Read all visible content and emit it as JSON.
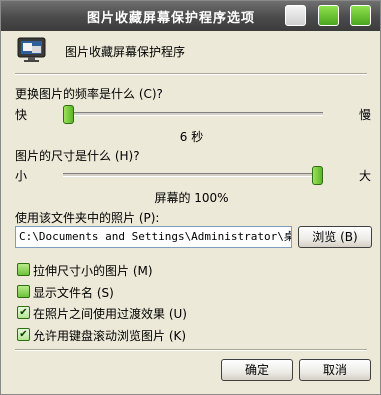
{
  "window": {
    "title": "图片收藏屏幕保护程序选项"
  },
  "header": {
    "app_name": "图片收藏屏幕保护程序"
  },
  "frequency": {
    "question": "更换图片的频率是什么 (C)?",
    "min_label": "快",
    "max_label": "慢",
    "value_text": "6 秒",
    "level": 0.0
  },
  "size": {
    "question": "图片的尺寸是什么 (H)?",
    "min_label": "小",
    "max_label": "大",
    "value_text": "屏幕的 100%",
    "level": 1.0
  },
  "folder": {
    "label": "使用该文件夹中的照片 (P):",
    "path": "C:\\Documents and Settings\\Administrator\\桌面\\",
    "browse_label": "浏览 (B)"
  },
  "options": [
    {
      "label": "拉伸尺寸小的图片 (M)",
      "checked": false
    },
    {
      "label": "显示文件名 (S)",
      "checked": false
    },
    {
      "label": "在照片之间使用过渡效果 (U)",
      "checked": true
    },
    {
      "label": "允许用键盘滚动浏览图片 (K)",
      "checked": true
    }
  ],
  "footer": {
    "ok_label": "确定",
    "cancel_label": "取消"
  }
}
